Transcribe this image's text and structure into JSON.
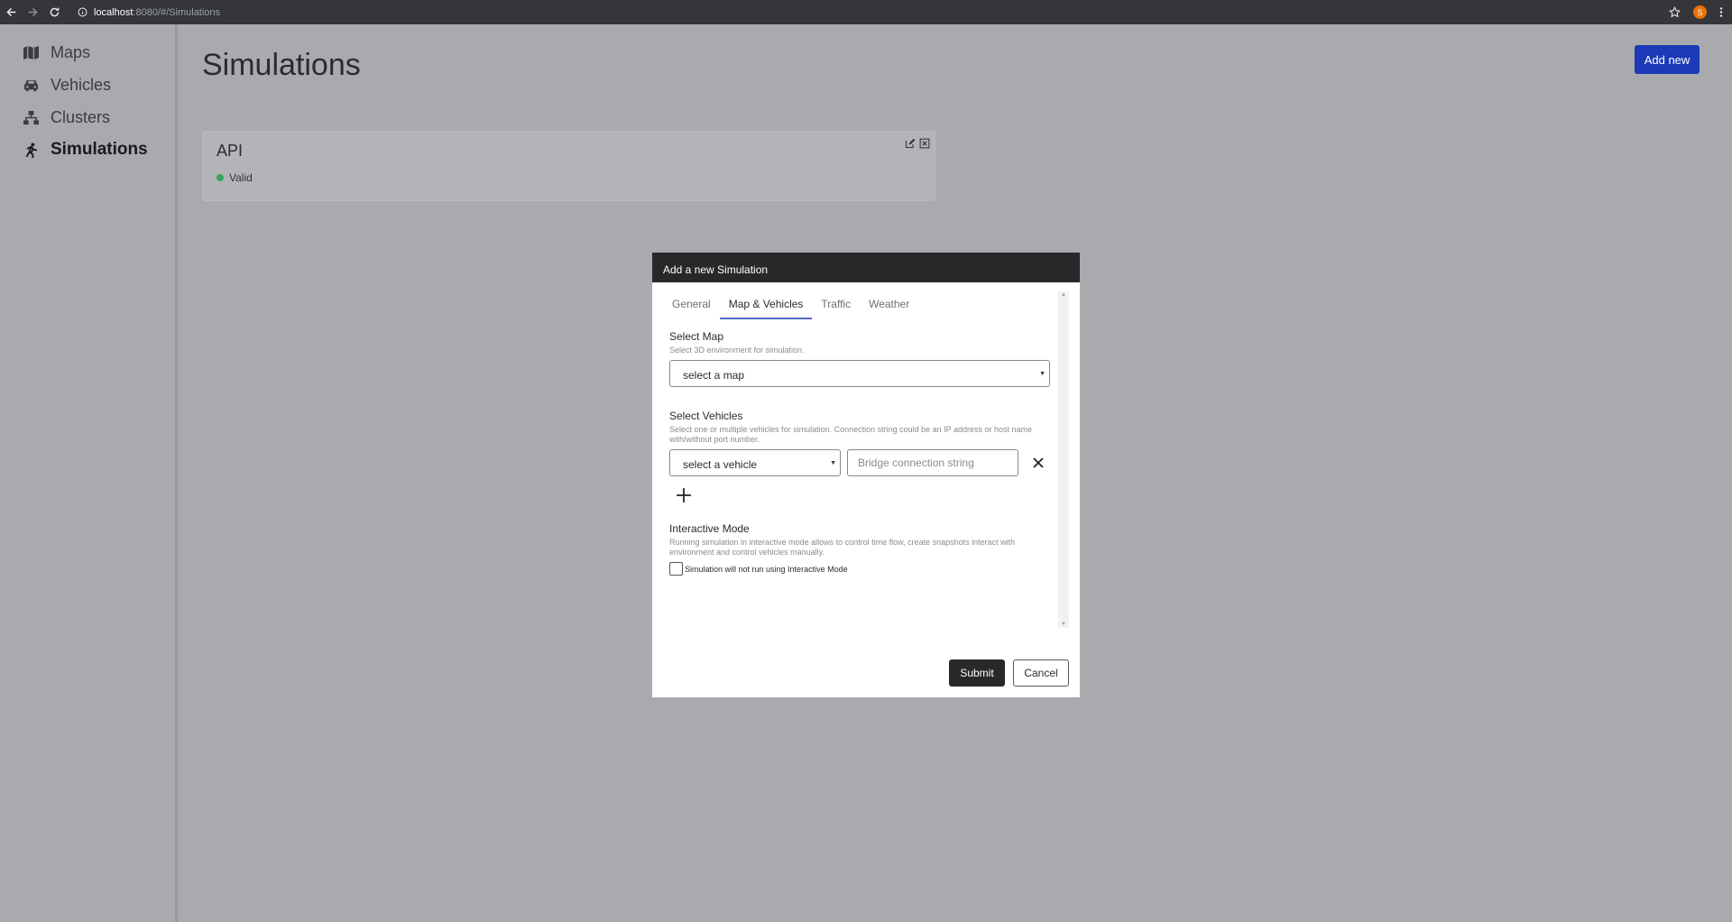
{
  "browser": {
    "url_host": "localhost",
    "url_path": ":8080/#/Simulations",
    "avatar_letter": "S"
  },
  "sidebar": {
    "items": [
      {
        "label": "Maps",
        "icon": "map-icon"
      },
      {
        "label": "Vehicles",
        "icon": "car-icon"
      },
      {
        "label": "Clusters",
        "icon": "sitemap-icon"
      },
      {
        "label": "Simulations",
        "icon": "running-person-icon",
        "active": true
      }
    ]
  },
  "main": {
    "title": "Simulations",
    "add_new_label": "Add new",
    "cards": [
      {
        "name": "API",
        "status": "Valid",
        "status_color": "#3aa65b"
      }
    ]
  },
  "modal": {
    "title": "Add a new Simulation",
    "tabs": [
      {
        "label": "General"
      },
      {
        "label": "Map & Vehicles",
        "active": true
      },
      {
        "label": "Traffic"
      },
      {
        "label": "Weather"
      }
    ],
    "map_section": {
      "title": "Select Map",
      "description": "Select 3D environment for simulation.",
      "select_value": "select a map"
    },
    "vehicles_section": {
      "title": "Select Vehicles",
      "description": "Select one or multiple vehicles for simulation. Connection string could be an IP address or host name with/without port number.",
      "select_value": "select a vehicle",
      "connection_placeholder": "Bridge connection string"
    },
    "interactive_section": {
      "title": "Interactive Mode",
      "description": "Running simulation in interactive mode allows to control time flow, create snapshots interact with environment and control vehicles manually.",
      "checkbox_label": "Simulation will not run using Interactive Mode",
      "checked": false
    },
    "submit_label": "Submit",
    "cancel_label": "Cancel"
  },
  "colors": {
    "accent": "#1c39b8",
    "tab_underline": "#5469c7",
    "modal_header": "#272829",
    "status_valid": "#3aa65b"
  }
}
